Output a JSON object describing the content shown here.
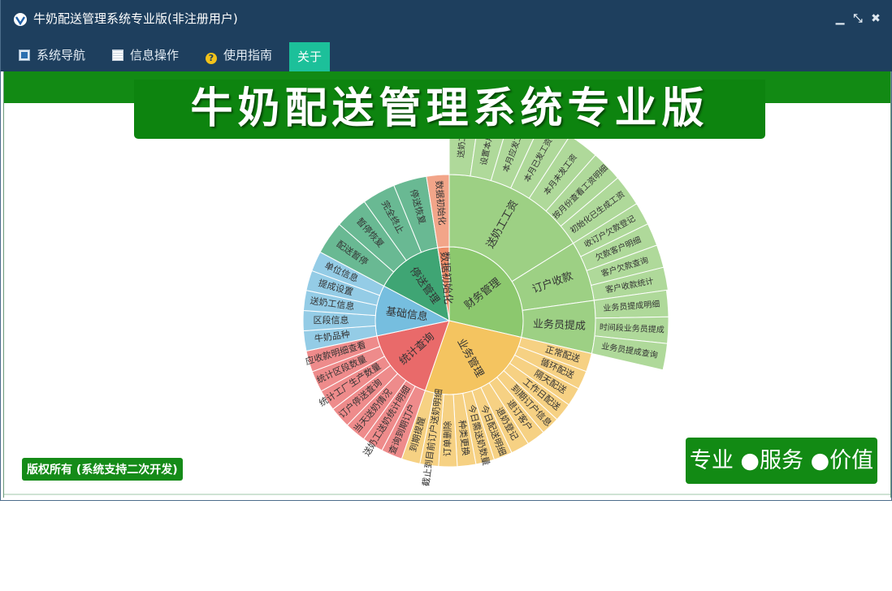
{
  "window": {
    "title": "牛奶配送管理系统专业版(非注册用户)",
    "minimize_label": "▁",
    "restore_label": "⤡",
    "close_label": "✖"
  },
  "menu": {
    "items": [
      {
        "label": "系统导航",
        "icon": "window-icon"
      },
      {
        "label": "信息操作",
        "icon": "grid-icon"
      },
      {
        "label": "使用指南",
        "icon": "help-icon"
      },
      {
        "label": "关于",
        "icon": ""
      }
    ],
    "active": "关于"
  },
  "content": {
    "banner_title": "牛奶配送管理系统专业版",
    "copyright": "版权所有 (系统支持二次开发)",
    "slogan": "专业 ●服务 ●价值"
  },
  "colors": {
    "titlebar": "#1e3f5e",
    "active_tab": "#1cc09a",
    "banner_green": "#0d840f"
  },
  "chart_data": {
    "type": "sunburst",
    "groups": [
      {
        "name": "财务管理",
        "color": "#8cc86e",
        "children": [
          {
            "name": "送奶工工资",
            "children": [
              "送奶工送奶",
              "设置本月工资",
              "本月应发工资",
              "本月已发工资",
              "本月未发工资",
              "按月份查看工资明细",
              "初始化已生成工资"
            ]
          },
          {
            "name": "订户收款",
            "children": [
              "收订户欠款登记",
              "欠款客户明细",
              "客户欠款查询",
              "客户收款统计"
            ]
          },
          {
            "name": "业务员提成",
            "children": [
              "业务员提成明细",
              "时间段业务员提成",
              "业务员提成查询"
            ]
          }
        ]
      },
      {
        "name": "业务管理",
        "color": "#f4c460",
        "children": [
          "正常配送",
          "循环配送",
          "隔天配送",
          "工作日配送",
          "到期订户信息",
          "退订客户",
          "退奶登记",
          "今日配送明细",
          "今日需送奶数量",
          "种类更换",
          "订单删除",
          "截止到目前订户送奶明细",
          "到期提醒"
        ]
      },
      {
        "name": "统计查询",
        "color": "#e96a6a",
        "children": [
          "查询到期订户",
          "送奶工送奶统计明细",
          "当天送奶情况",
          "订户停送查询",
          "统计工厂生产数量",
          "统计区段数量",
          "应收款明细查看"
        ]
      },
      {
        "name": "基础信息",
        "color": "#76bedf",
        "children": [
          "牛奶品种",
          "区段信息",
          "送奶工信息",
          "提成设置",
          "单位信息"
        ]
      },
      {
        "name": "停送管理",
        "color": "#3fa574",
        "children": [
          "配送暂停",
          "暂停恢复",
          "完全终止",
          "停送恢复"
        ]
      },
      {
        "name": "数据初始化",
        "color": "#ee8c68",
        "children": [
          "数据初始化"
        ]
      }
    ]
  }
}
